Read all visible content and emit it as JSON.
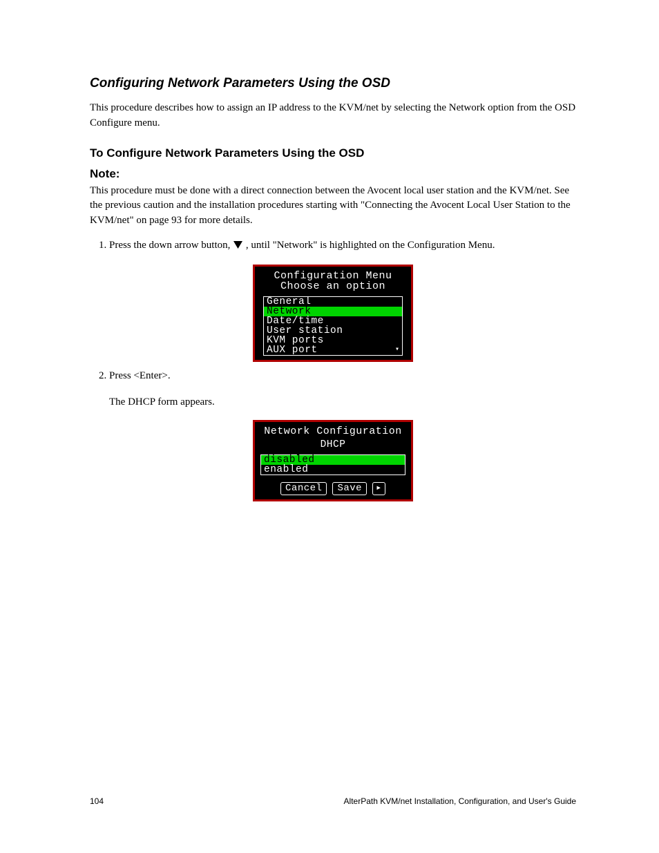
{
  "section": {
    "title": "Configuring Network Parameters Using the OSD",
    "intro": "This procedure describes how to assign an IP address to the KVM/net by selecting the Network option from the OSD Configure menu.",
    "sub_heading": "To Configure Network Parameters Using the OSD",
    "note_label": "Note:",
    "note_text": "This procedure must be done with a direct connection between the Avocent local user station and the KVM/net. See the previous caution and the installation procedures starting with \"Connecting the Avocent Local User Station to the KVM/net\" on page 93 for more details.",
    "steps": [
      {
        "text_prefix": "Press the down arrow button, ",
        "text_suffix": ", until \"Network\" is highlighted on the Configuration Menu."
      },
      {
        "text": "Press <Enter>."
      },
      {
        "text": "The DHCP form appears."
      }
    ],
    "fig1_caption": "",
    "fig2_caption": ""
  },
  "osd1": {
    "title_line1": "Configuration Menu",
    "title_line2": "Choose an option",
    "items": [
      "General",
      "Network",
      "Date/time",
      "User station",
      "KVM ports",
      "AUX port"
    ],
    "selected_index": 1,
    "scroll_indicator": "▾"
  },
  "osd2": {
    "title": "Network Configuration",
    "sub": "DHCP",
    "options": [
      "disabled",
      "enabled"
    ],
    "selected_index": 0,
    "buttons": {
      "cancel": "Cancel",
      "save": "Save",
      "next": "▸"
    }
  },
  "footer": {
    "left": "104",
    "right": "AlterPath KVM/net Installation, Configuration, and User's Guide"
  }
}
